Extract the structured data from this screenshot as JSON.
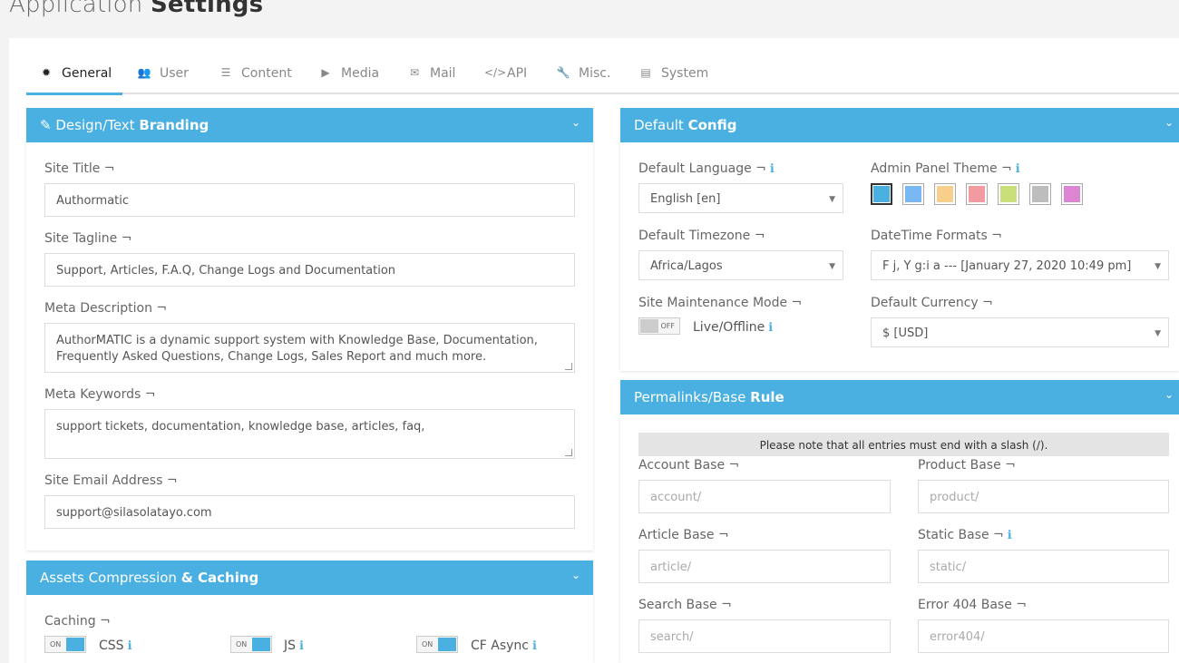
{
  "page_title": {
    "light": "Application ",
    "bold": "Settings"
  },
  "tabs": [
    {
      "label": "General",
      "icon": "gear-icon",
      "glyph": "✹",
      "active": true
    },
    {
      "label": "User",
      "icon": "users-icon",
      "glyph": "👥"
    },
    {
      "label": "Content",
      "icon": "list-icon",
      "glyph": "☰"
    },
    {
      "label": "Media",
      "icon": "video-icon",
      "glyph": "▶"
    },
    {
      "label": "Mail",
      "icon": "envelope-icon",
      "glyph": "✉"
    },
    {
      "label": "API",
      "icon": "code-icon",
      "glyph": "</>"
    },
    {
      "label": "Misc.",
      "icon": "wrench-icon",
      "glyph": "🔧"
    },
    {
      "label": "System",
      "icon": "server-icon",
      "glyph": "▤"
    }
  ],
  "branding": {
    "title_light": "Design/Text ",
    "title_bold": "Branding",
    "site_title_label": "Site Title ¬",
    "site_title_value": "Authormatic",
    "site_tagline_label": "Site Tagline ¬",
    "site_tagline_value": "Support, Articles, F.A.Q, Change Logs and Documentation",
    "meta_description_label": "Meta Description ¬",
    "meta_description_value": "AuthorMATIC is a dynamic support system with Knowledge Base, Documentation, Frequently Asked Questions, Change Logs, Sales Report and much more.",
    "meta_keywords_label": "Meta Keywords ¬",
    "meta_keywords_value": "support tickets, documentation, knowledge base, articles, faq,",
    "site_email_label": "Site Email Address ¬",
    "site_email_value": "support@silasolatayo.com"
  },
  "assets": {
    "title_light": "Assets Compression ",
    "title_bold": "& Caching",
    "caching_label": "Caching ¬",
    "toggles": [
      {
        "label": "CSS",
        "state": "ON"
      },
      {
        "label": "JS",
        "state": "ON"
      },
      {
        "label": "CF Async",
        "state": "ON"
      }
    ]
  },
  "default_config": {
    "title_light": "Default ",
    "title_bold": "Config",
    "language_label": "Default Language ¬",
    "language_value": "English [en]",
    "theme_label": "Admin Panel Theme ¬",
    "theme_colors": [
      "#4ab0e2",
      "#79b8f3",
      "#f7cf8a",
      "#f29a9f",
      "#c9e07a",
      "#bdbdbd",
      "#dc86d3"
    ],
    "timezone_label": "Default Timezone ¬",
    "timezone_value": "Africa/Lagos",
    "datetime_label": "DateTime Formats ¬",
    "datetime_value": "F j, Y g:i a --- [January 27, 2020 10:49 pm]",
    "maintenance_label": "Site Maintenance Mode ¬",
    "maintenance_state": "OFF",
    "maintenance_text": "Live/Offline",
    "currency_label": "Default Currency ¬",
    "currency_value": "$ [USD]"
  },
  "permalinks": {
    "title_light": "Permalinks/Base ",
    "title_bold": "Rule",
    "note": "Please note that all entries must end with a slash (/).",
    "account_label": "Account Base ¬",
    "account_placeholder": "account/",
    "product_label": "Product Base ¬",
    "product_placeholder": "product/",
    "article_label": "Article Base ¬",
    "article_placeholder": "article/",
    "static_label": "Static Base ¬",
    "static_placeholder": "static/",
    "search_label": "Search Base ¬",
    "search_placeholder": "search/",
    "error_label": "Error 404 Base ¬",
    "error_placeholder": "error404/"
  },
  "icons": {
    "edit": "✎",
    "chevron": "⌄",
    "info": "ℹ",
    "arrow": "▼"
  }
}
